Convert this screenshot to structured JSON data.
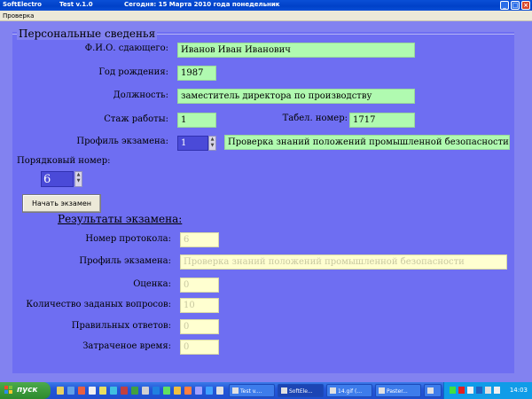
{
  "titlebar": {
    "app": "SoftElectro",
    "version": "Test v.1.0",
    "date": "Сегодня: 15  Марта  2010 года  понедельник"
  },
  "menubar": {
    "item": "Проверка"
  },
  "personal": {
    "title": "Персональные сведенья",
    "fio_label": "Ф.И.О. сдающего:",
    "fio_value": "Иванов Иван Иванович",
    "birth_label": "Год рождения:",
    "birth_value": "1987",
    "position_label": "Должность:",
    "position_value": "заместитель директора по производству",
    "experience_label": "Стаж работы:",
    "experience_value": "1",
    "tab_label": "Табел. номер:",
    "tab_value": "1717",
    "profile_label": "Профиль экзамена:",
    "profile_num": "1",
    "profile_value": "Проверка знаний положений промышленной безопасности",
    "seq_label": "Порядковый номер:",
    "seq_value": "6"
  },
  "start_button": "Начать экзамен",
  "results": {
    "title": "Результаты экзамена:",
    "protocol_label": "Номер протокола:",
    "protocol_value": "6",
    "profile_label": "Профиль экзамена:",
    "profile_value": "Проверка знаний положений промышленной безопасности",
    "grade_label": "Оценка:",
    "grade_value": "0",
    "questions_label": "Количество заданых вопросов:",
    "questions_value": "10",
    "correct_label": "Правильных ответов:",
    "correct_value": "0",
    "time_label": "Затраченое время:",
    "time_value": "0"
  },
  "taskbar": {
    "start": "пуск",
    "tasks": [
      "Test v....",
      "SoftEle...",
      "14.gif (...",
      "Paster..."
    ],
    "clock": "14:03"
  }
}
